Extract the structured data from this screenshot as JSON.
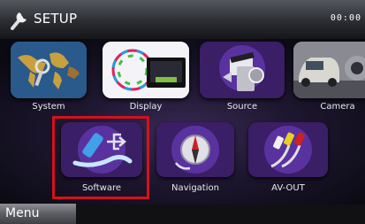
{
  "header": {
    "title": "SETUP",
    "clock": "00:00",
    "title_icon": "wrench-icon"
  },
  "tiles_row1": [
    {
      "label": "System",
      "icon": "world-map-icon"
    },
    {
      "label": "Display",
      "icon": "display-icon"
    },
    {
      "label": "Source",
      "icon": "media-clapper-icon"
    },
    {
      "label": "Camera",
      "icon": "car-camera-icon"
    }
  ],
  "tiles_row2": [
    {
      "label": "Software",
      "icon": "usb-software-icon",
      "selected": true
    },
    {
      "label": "Navigation",
      "icon": "navigation-compass-icon"
    },
    {
      "label": "AV-OUT",
      "icon": "av-cable-icon"
    }
  ],
  "footer": {
    "menu_label": "Menu"
  },
  "colors": {
    "highlight": "#d8101a",
    "accent_purple": "#5a2a8a"
  }
}
